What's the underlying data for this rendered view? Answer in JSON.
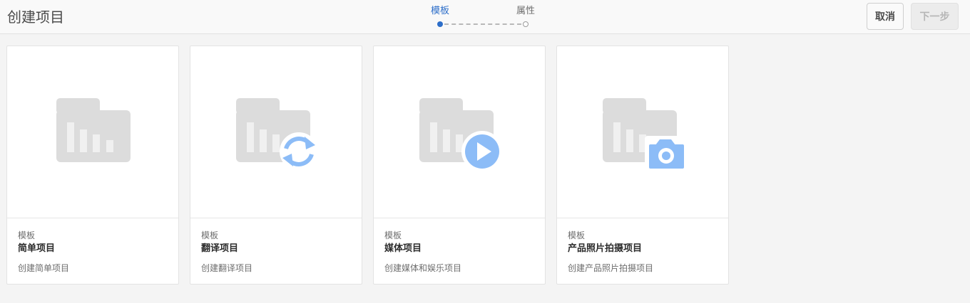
{
  "header": {
    "title": "创建项目",
    "steps": [
      {
        "label": "模板",
        "active": true
      },
      {
        "label": "属性",
        "active": false
      }
    ],
    "cancel_label": "取消",
    "next_label": "下一步"
  },
  "colors": {
    "accent": "#2d6ec9",
    "overlay_icon": "#8cbcf7",
    "folder": "#dcdcdc"
  },
  "cards": [
    {
      "kind": "模板",
      "name": "简单项目",
      "description": "创建简单项目",
      "icon": "folder-chart-icon"
    },
    {
      "kind": "模板",
      "name": "翻译项目",
      "description": "创建翻译项目",
      "icon": "folder-sync-icon"
    },
    {
      "kind": "模板",
      "name": "媒体项目",
      "description": "创建媒体和娱乐项目",
      "icon": "folder-play-icon"
    },
    {
      "kind": "模板",
      "name": "产品照片拍摄项目",
      "description": "创建产品照片拍摄项目",
      "icon": "folder-camera-icon"
    }
  ]
}
